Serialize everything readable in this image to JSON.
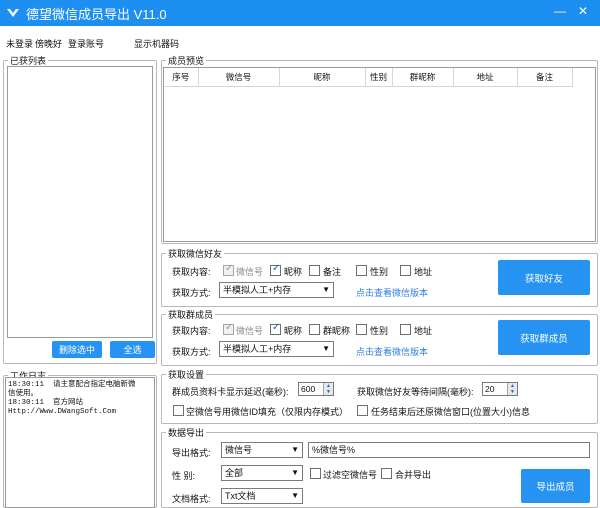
{
  "titlebar": {
    "title": "德望微信成员导出 V11.0",
    "minimize_label": "—",
    "close_label": "✕"
  },
  "menu": {
    "login_status": "未登录",
    "username": "傍晚好",
    "login_account": "登录账号",
    "show_machine_code": "显示机器码"
  },
  "obtained_list": {
    "legend": "已获列表",
    "delete_selected": "删除选中",
    "select_all": "全选"
  },
  "work_log": {
    "legend": "工作日志",
    "lines": [
      "18:30:11  请主意配合指定电脑新微",
      "信使用。",
      "18:30:11  官方网站",
      "Http://Www.DWangSoft.Com"
    ]
  },
  "preview": {
    "legend": "成员预览",
    "columns": [
      "序号",
      "微信号",
      "昵称",
      "性别",
      "群昵称",
      "地址",
      "备注"
    ]
  },
  "friends": {
    "legend": "获取微信好友",
    "content_label": "获取内容:",
    "options": [
      {
        "label": "微信号",
        "checked": true,
        "disabled": true
      },
      {
        "label": "昵称",
        "checked": true,
        "disabled": false
      },
      {
        "label": "备注",
        "checked": false,
        "disabled": false
      },
      {
        "label": "性别",
        "checked": false,
        "disabled": false
      },
      {
        "label": "地址",
        "checked": false,
        "disabled": false
      }
    ],
    "method_label": "获取方式:",
    "method_value": "半模拟人工+内存",
    "link": "点击查看微信版本",
    "button": "获取好友"
  },
  "groups": {
    "legend": "获取群成员",
    "content_label": "获取内容:",
    "options": [
      {
        "label": "微信号",
        "checked": true,
        "disabled": true
      },
      {
        "label": "昵称",
        "checked": true,
        "disabled": false
      },
      {
        "label": "群昵称",
        "checked": false,
        "disabled": false
      },
      {
        "label": "性别",
        "checked": false,
        "disabled": false
      },
      {
        "label": "地址",
        "checked": false,
        "disabled": false
      }
    ],
    "method_label": "获取方式:",
    "method_value": "半模拟人工+内存",
    "link": "点击查看微信版本",
    "button": "获取群成员"
  },
  "settings": {
    "legend": "获取设置",
    "delay_label": "群成员资料卡显示延迟(毫秒):",
    "delay_value": "600",
    "interval_label": "获取微信好友等待间隔(毫秒):",
    "interval_value": "20",
    "fill_empty_label": "空微信号用微信ID填充（仅限内存模式）",
    "restore_window_label": "任务结束后还原微信窗口(位置大小)信息"
  },
  "export": {
    "legend": "数据导出",
    "format_label": "导出格式:",
    "format_value": "微信号",
    "template_value": "%微信号%",
    "gender_label": "性  别:",
    "gender_value": "全部",
    "filter_empty_label": "过滤空微信号",
    "merge_export_label": "合并导出",
    "doc_format_label": "文档格式:",
    "doc_format_value": "Txt文档",
    "button": "导出成员"
  },
  "colors": {
    "titlebar": "#1d8ff0",
    "button": "#2693f2",
    "link": "#2f7de0"
  }
}
